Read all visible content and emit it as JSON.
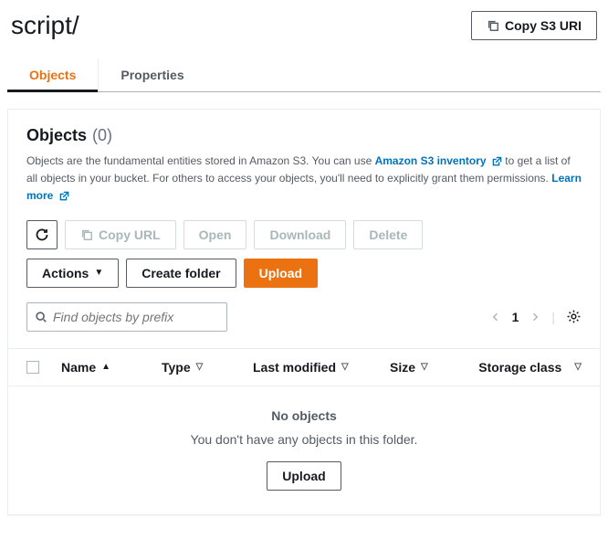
{
  "header": {
    "title": "script/",
    "copy_uri_label": "Copy S3 URI"
  },
  "tabs": {
    "objects": "Objects",
    "properties": "Properties"
  },
  "panel": {
    "title": "Objects",
    "count": "(0)",
    "desc_pre": "Objects are the fundamental entities stored in Amazon S3. You can use ",
    "inventory_link": "Amazon S3 inventory",
    "desc_mid": " to get a list of all objects in your bucket. For others to access your objects, you'll need to explicitly grant them permissions. ",
    "learn_more": "Learn more"
  },
  "buttons": {
    "copy_url": "Copy URL",
    "open": "Open",
    "download": "Download",
    "delete": "Delete",
    "actions": "Actions",
    "create_folder": "Create folder",
    "upload": "Upload"
  },
  "search": {
    "placeholder": "Find objects by prefix"
  },
  "pager": {
    "page": "1"
  },
  "columns": {
    "name": "Name",
    "type": "Type",
    "modified": "Last modified",
    "size": "Size",
    "storage_class": "Storage class"
  },
  "empty": {
    "title": "No objects",
    "subtitle": "You don't have any objects in this folder.",
    "upload": "Upload"
  }
}
